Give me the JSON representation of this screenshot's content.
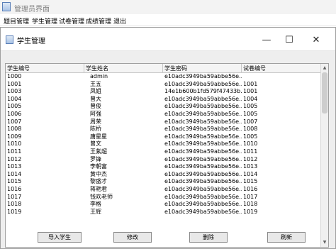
{
  "outer_window": {
    "title": "管理员界面"
  },
  "menu": [
    "题目管理",
    "学生管理",
    "试卷管理",
    "成绩管理",
    "退出"
  ],
  "inner_window": {
    "title": "学生管理",
    "minimize_glyph": "—",
    "maximize_glyph": "☐",
    "close_glyph": "✕"
  },
  "table": {
    "columns": [
      "学生编号",
      "学生姓名",
      "学生密码",
      "试卷编号"
    ],
    "rows": [
      [
        "1000",
        "admin",
        "e10adc3949ba59abbe56e...",
        ""
      ],
      [
        "1001",
        "王五",
        "e10adc3949ba59abbe56e...",
        "1001"
      ],
      [
        "1003",
        "凤姐",
        "14e1b600b1fd579f47433b...",
        "1001"
      ],
      [
        "1004",
        "曾大",
        "e10adc3949ba59abbe56e...",
        "1004"
      ],
      [
        "1005",
        "曾俊",
        "e10adc3949ba59abbe56e...",
        "1005"
      ],
      [
        "1006",
        "阿强",
        "e10adc3949ba59abbe56e...",
        "1005"
      ],
      [
        "1007",
        "周荣",
        "e10adc3949ba59abbe56e...",
        "1007"
      ],
      [
        "1008",
        "陈桥",
        "e10adc3949ba59abbe56e...",
        "1008"
      ],
      [
        "1009",
        "唐星星",
        "e10adc3949ba59abbe56e...",
        "1005"
      ],
      [
        "1010",
        "曾文",
        "e10adc3949ba59abbe56e...",
        "1010"
      ],
      [
        "1011",
        "王紫超",
        "e10adc3949ba59abbe56e...",
        "1011"
      ],
      [
        "1012",
        "罗锋",
        "e10adc3949ba59abbe56e...",
        "1012"
      ],
      [
        "1013",
        "李朝富",
        "e10adc3949ba59abbe56e...",
        "1013"
      ],
      [
        "1014",
        "黄中杰",
        "e10adc3949ba59abbe56e...",
        "1014"
      ],
      [
        "1015",
        "黎盛才",
        "e10adc3949ba59abbe56e...",
        "1015"
      ],
      [
        "1016",
        "蒋艳君",
        "e10adc3949ba59abbe56e...",
        "1016"
      ],
      [
        "1017",
        "钱欢老师",
        "e10adc3949ba59abbe56e...",
        "1017"
      ],
      [
        "1018",
        "李格",
        "e10adc3949ba59abbe56e...",
        "1018"
      ],
      [
        "1019",
        "王辉",
        "e10adc3949ba59abbe56e...",
        "1019"
      ]
    ]
  },
  "buttons": {
    "import": "导入学生",
    "edit": "修改",
    "delete": "删除",
    "refresh": "刷新"
  }
}
